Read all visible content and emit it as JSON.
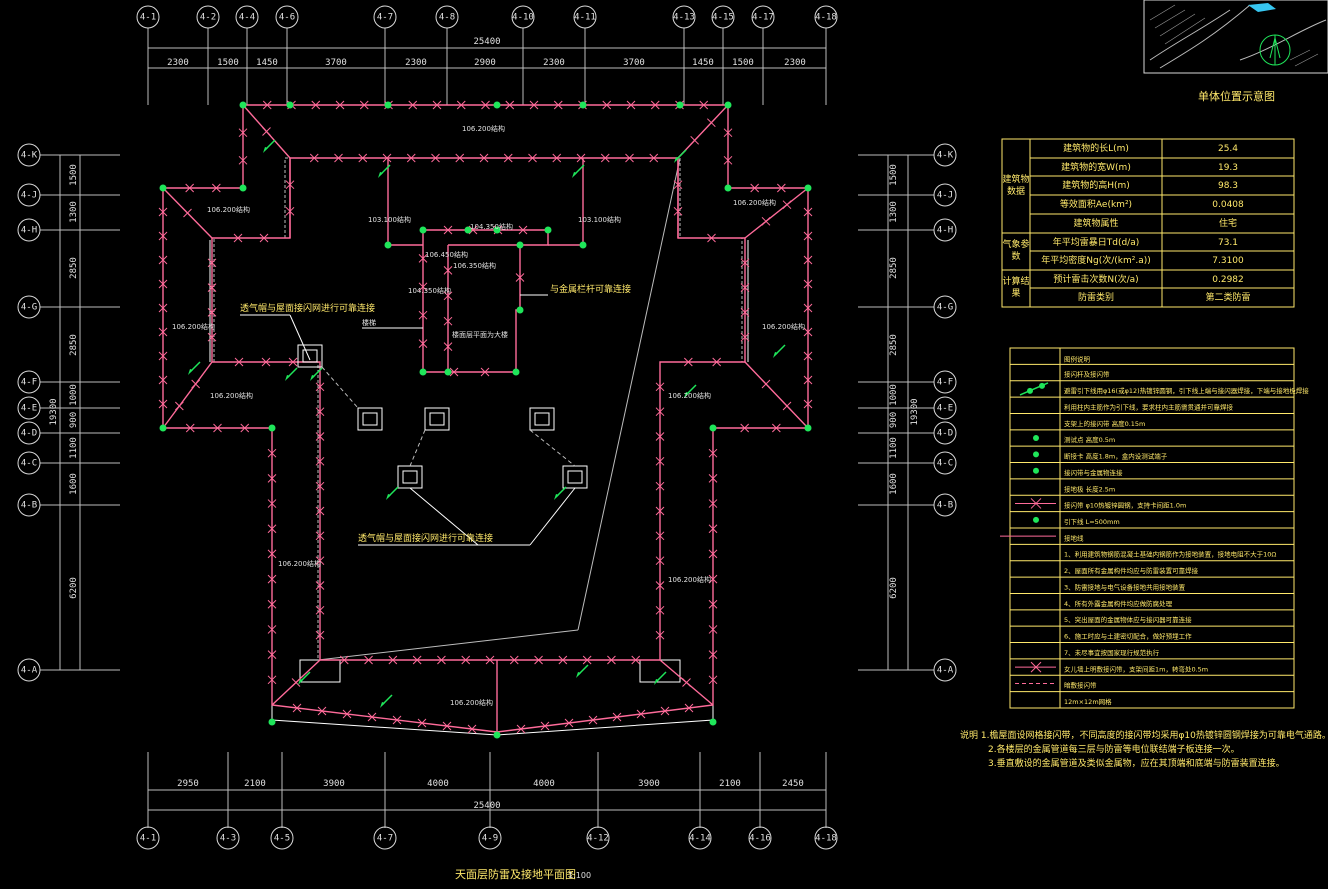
{
  "colors": {
    "background": "#000000",
    "wall": "#ffffff",
    "lightning_net": "#ff6b9a",
    "rod": "#1fe65a",
    "annotation": "#ffe96b"
  },
  "axes_top": [
    "4-1",
    "4-2",
    "4-4",
    "4-6",
    "4-7",
    "4-8",
    "4-10",
    "4-11",
    "4-13",
    "4-15",
    "4-17",
    "4-18"
  ],
  "axes_bottom": [
    "4-1",
    "4-3",
    "4-5",
    "4-7",
    "4-9",
    "4-12",
    "4-14",
    "4-16",
    "4-18"
  ],
  "axes_side": [
    "4-K",
    "4-J",
    "4-H",
    "4-G",
    "4-F",
    "4-E",
    "4-D",
    "4-C",
    "4-B",
    "4-A"
  ],
  "dims_top_total": "25400",
  "dims_top": [
    "2300",
    "1500",
    "1450",
    "3700",
    "2300",
    "2900",
    "2300",
    "3700",
    "1450",
    "1500",
    "2300"
  ],
  "dims_bottom_total": "25400",
  "dims_bottom": [
    "2950",
    "2100",
    "3900",
    "4000",
    "4000",
    "3900",
    "2100",
    "2450"
  ],
  "dims_side": [
    "1500",
    "1300",
    "2850",
    "2850",
    "1000",
    "900",
    "1100",
    "1600",
    "6200"
  ],
  "dims_side_total": "19300",
  "elevation_labels": {
    "ridge": "106.200结构",
    "left_upper": "106.200结构",
    "left_mid": "106.200结构",
    "left_lower": "106.200结构",
    "left_bottom": "106.200结构",
    "right_upper": "106.200结构",
    "right_mid": "106.200结构",
    "right_lower": "106.200结构",
    "right_bottom": "106.200结构",
    "bottom": "106.200结构",
    "core_a": "103.100结构",
    "core_b": "104.350结构",
    "core_c": "106.450结构",
    "core_d": "106.350结构",
    "core_e": "104.350结构",
    "core_f": "103.100结构"
  },
  "annotations": {
    "vent_top": "透气帽与屋面接闪网进行可靠连接",
    "vent_bottom": "透气帽与屋面接闪网进行可靠连接",
    "metal_rail": "与金属栏杆可靠连接",
    "stair": "楼梯",
    "core_note": "楼面层平面为大楼"
  },
  "location_title": "单体位置示意图",
  "calc_table": {
    "groups": [
      "建筑物数据",
      "气象参数",
      "计算结果"
    ],
    "rows": [
      {
        "label": "建筑物的长L(m)",
        "value": "25.4"
      },
      {
        "label": "建筑物的宽W(m)",
        "value": "19.3"
      },
      {
        "label": "建筑物的高H(m)",
        "value": "98.3"
      },
      {
        "label": "等效面积Ae(km²)",
        "value": "0.0408"
      },
      {
        "label": "建筑物属性",
        "value": "住宅"
      },
      {
        "label": "年平均雷暴日Td(d/a)",
        "value": "73.1"
      },
      {
        "label": "年平均密度Ng(次/(km².a))",
        "value": "7.3100"
      },
      {
        "label": "预计雷击次数N(次/a)",
        "value": "0.2982"
      },
      {
        "label": "防雷类别",
        "value": "第二类防雷"
      }
    ]
  },
  "legend": {
    "title": "图例说明",
    "rows": [
      "接闪杆及接闪带",
      "避雷引下线用φ16(或φ12)热镀锌圆钢，引下线上端与接闪器焊接，下端与接地极焊接",
      "利用柱内主筋作为引下线，要求柱内主筋需贯通并可靠焊接",
      "支架上的接闪带 高度0.15m",
      "测试点 高度0.5m",
      "断接卡 高度1.8m，盒内设测试端子",
      "接闪带与金属物连接",
      "接地极 长度2.5m",
      "接闪带 φ10热镀锌圆钢，支持卡间距1.0m",
      "引下线 L=500mm",
      "接地线",
      "1、利用建筑物钢筋混凝土基础内钢筋作为接地装置，接地电阻不大于10Ω",
      "2、屋面所有金属构件均应与防雷装置可靠焊接",
      "3、防雷接地与电气设备接地共用接地装置",
      "4、所有外露金属构件均应做防腐处理",
      "5、突出屋面的金属物体应与接闪器可靠连接",
      "6、施工时应与土建密切配合，做好预埋工作",
      "7、未尽事宜按国家现行规范执行",
      "女儿墙上明敷接闪带，支架间距1m，转弯处0.5m",
      "暗敷接闪带",
      "12m×12m网格"
    ]
  },
  "notes": [
    "说明 1.檐屋面设网格接闪带，不同高度的接闪带均采用φ10热镀锌圆钢焊接为可靠电气通路。",
    "2.各楼层的金属管道每三层与防雷等电位联结端子板连接一次。",
    "3.垂直敷设的金属管道及类似金属物，应在其顶端和底端与防雷装置连接。"
  ],
  "drawing_title": "天面层防雷及接地平面图",
  "drawing_scale": "1:100"
}
